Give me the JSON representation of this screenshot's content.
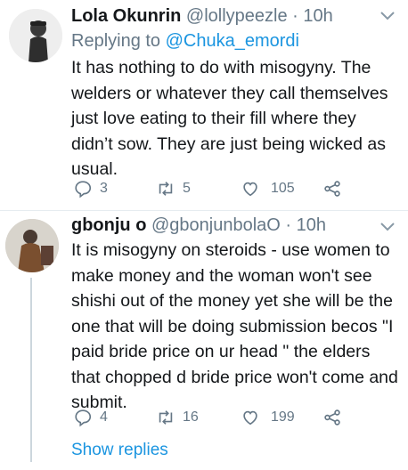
{
  "tweets": [
    {
      "name": "Lola Okunrin",
      "handle": "@lollypeezle",
      "time": "· 10h",
      "replying_label": "Replying to",
      "replying_to": "@Chuka_emordi",
      "text": "It has nothing to do with misogyny. The welders or whatever they call themselves just love eating to their fill where they didn’t sow. They are just being wicked as usual.",
      "replies": "3",
      "retweets": "5",
      "likes": "105"
    },
    {
      "name": "gbonju o",
      "handle": "@gbonjunbolaO",
      "time": "· 10h",
      "text": "It is misogyny on steroids - use women to make money and the woman won't see shishi out of the money yet she will be the one that will be doing submission becos \"I paid bride price on ur head \" the elders that chopped d bride price won't come and submit.",
      "replies": "4",
      "retweets": "16",
      "likes": "199"
    }
  ],
  "show_replies": "Show replies",
  "colors": {
    "link": "#1b95e0",
    "muted": "#657786",
    "divider": "#e6ecf0"
  },
  "icons": [
    "chevron-down-icon",
    "reply-icon",
    "retweet-icon",
    "like-icon",
    "share-icon"
  ]
}
